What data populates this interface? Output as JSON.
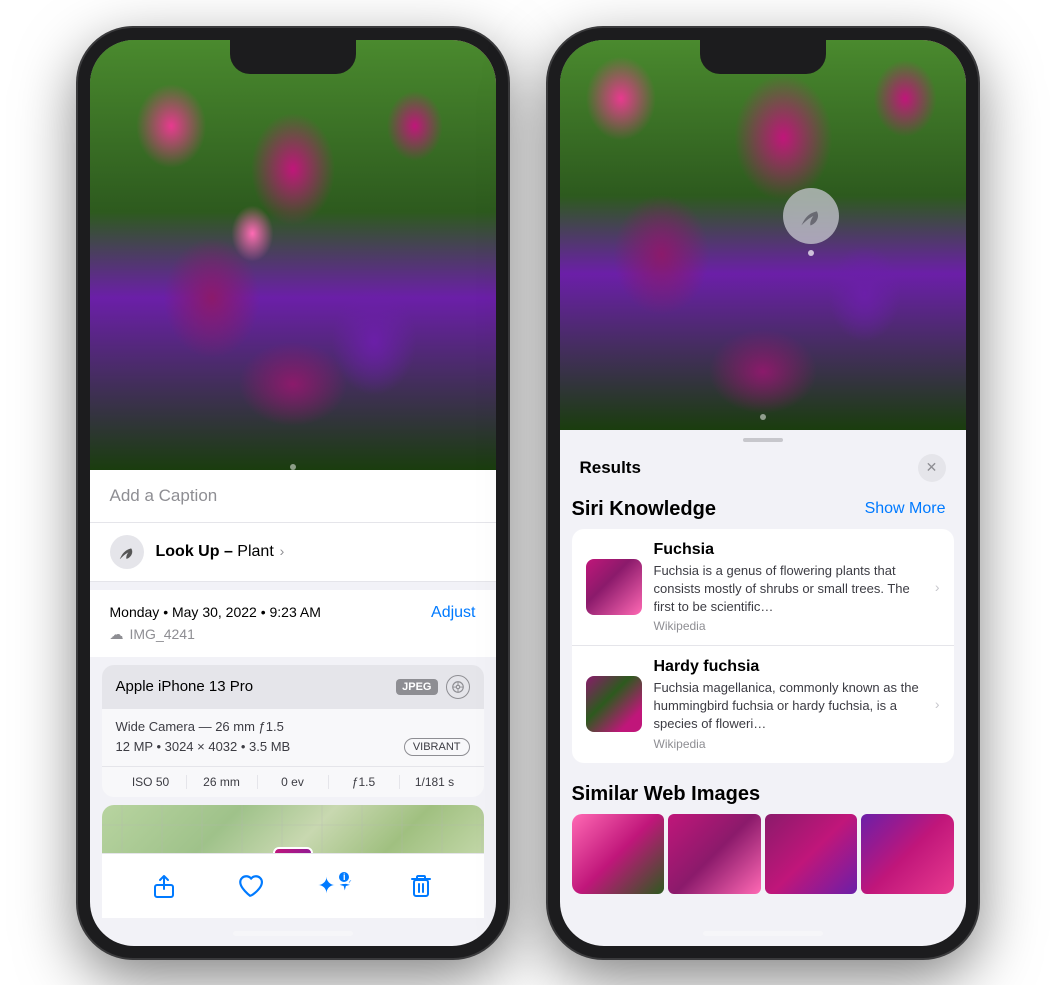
{
  "left_phone": {
    "caption_placeholder": "Add a Caption",
    "lookup": {
      "label_bold": "Look Up –",
      "label_regular": " Plant",
      "chevron": "›"
    },
    "photo_info": {
      "date": "Monday • May 30, 2022 • 9:23 AM",
      "adjust_label": "Adjust",
      "filename": "IMG_4241"
    },
    "camera": {
      "name": "Apple iPhone 13 Pro",
      "format": "JPEG",
      "wide_camera": "Wide Camera — 26 mm ƒ1.5",
      "megapixels": "12 MP • 3024 × 4032 • 3.5 MB",
      "filter": "VIBRANT",
      "iso": "ISO 50",
      "focal": "26 mm",
      "ev": "0 ev",
      "aperture": "ƒ1.5",
      "shutter": "1/181 s"
    },
    "toolbar": {
      "share": "⬆",
      "heart": "♡",
      "info": "✦",
      "info_badge": "i",
      "trash": "🗑"
    }
  },
  "right_phone": {
    "results": {
      "title": "Results",
      "close": "✕"
    },
    "siri_knowledge": {
      "section_title": "Siri Knowledge",
      "show_more": "Show More",
      "items": [
        {
          "name": "Fuchsia",
          "description": "Fuchsia is a genus of flowering plants that consists mostly of shrubs or small trees. The first to be scientific…",
          "source": "Wikipedia"
        },
        {
          "name": "Hardy fuchsia",
          "description": "Fuchsia magellanica, commonly known as the hummingbird fuchsia or hardy fuchsia, is a species of floweri…",
          "source": "Wikipedia"
        }
      ]
    },
    "similar_web": {
      "section_title": "Similar Web Images"
    }
  }
}
